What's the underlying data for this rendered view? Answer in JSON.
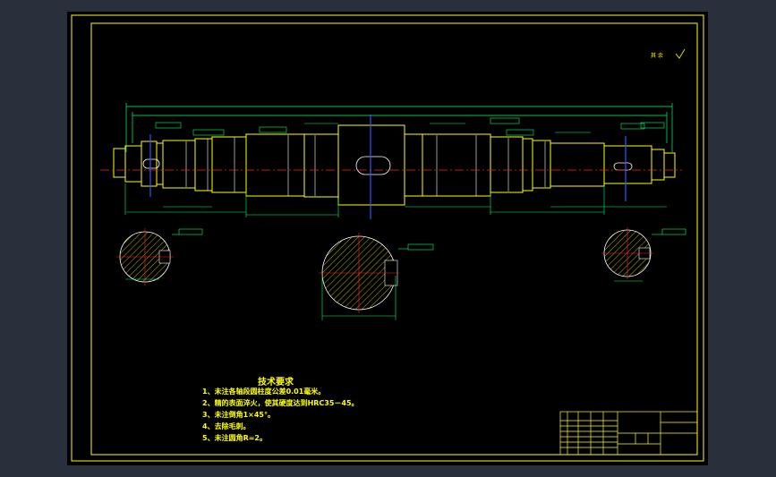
{
  "drawing": {
    "roughness_note": "其 余",
    "technical_requirements": {
      "title": "技术要求",
      "items": [
        "1、未注各轴段圆柱度公差0.01毫米。",
        "2、精的表面淬火，使其硬度达到HRC35－45。",
        "3、未注倒角1×45°。",
        "4、去除毛刺。",
        "5、未注圆角R=2。"
      ]
    }
  }
}
